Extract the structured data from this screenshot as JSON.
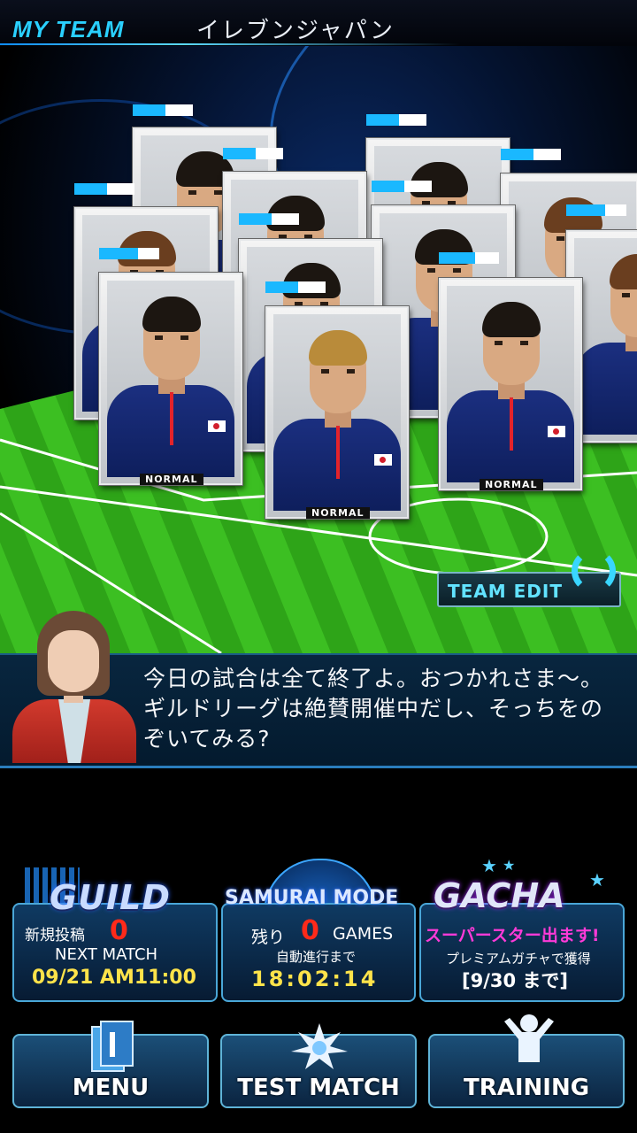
{
  "header": {
    "tag": "MY TEAM",
    "team_name": "イレブンジャパン"
  },
  "lineup": {
    "players": [
      {
        "gauge": 0.55,
        "card_label": ""
      },
      {
        "gauge": 0.55,
        "card_label": ""
      },
      {
        "gauge": 0.55,
        "card_label": ""
      },
      {
        "gauge": 0.55,
        "card_label": ""
      },
      {
        "gauge": 0.55,
        "card_label": ""
      },
      {
        "gauge": 0.55,
        "card_label": ""
      },
      {
        "gauge": 0.65,
        "card_label": ""
      },
      {
        "gauge": 0.55,
        "card_label": ""
      },
      {
        "gauge": 0.65,
        "card_label": ""
      },
      {
        "gauge": 0.6,
        "card_label": "NORMAL"
      },
      {
        "gauge": 0.55,
        "card_label": "NORMAL"
      },
      {
        "gauge": 0.7,
        "card_label": "NORMAL"
      }
    ],
    "team_edit_label": "TEAM EDIT"
  },
  "dialog": {
    "message": "今日の試合は全て終了よ。おつかれさま〜。ギルドリーグは絶賛開催中だし、そっちをのぞいてみる?"
  },
  "guild": {
    "title": "GUILD",
    "new_posts_label": "新規投稿",
    "new_posts_count": "0",
    "next_match_label": "NEXT MATCH",
    "next_match_time": "09/21 AM11:00"
  },
  "samurai": {
    "title": "SAMURAI MODE",
    "remaining_label": "残り",
    "remaining_count": "0",
    "games_label": "GAMES",
    "auto_label": "自動進行まで",
    "timer": "18:02:14"
  },
  "gacha": {
    "title": "GACHA",
    "banner": "スーパースター出ます!",
    "sub": "プレミアムガチャで獲得",
    "period": "[9/30 まで]"
  },
  "nav": {
    "menu": "MENU",
    "test_match": "TEST MATCH",
    "training": "TRAINING"
  },
  "colors": {
    "accent": "#1ab8ff",
    "pitch": "#38b81f",
    "dialog_bg": "#06223a",
    "gacha_pink": "#ff3ad8",
    "count_red": "#ff2a1a",
    "clock_yellow": "#ffe34a"
  }
}
